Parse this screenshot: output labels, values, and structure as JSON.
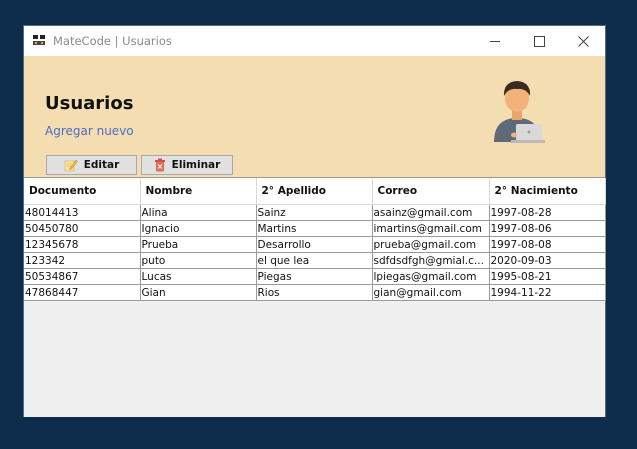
{
  "window": {
    "title": "MateCode | Usuarios"
  },
  "header": {
    "title": "Usuarios",
    "add_link": "Agregar nuevo",
    "background_color": "#f5ddb2"
  },
  "toolbar": {
    "edit_label": "Editar",
    "delete_label": "Eliminar"
  },
  "table": {
    "columns": [
      "Documento",
      "Nombre",
      "2° Apellido",
      "Correo",
      "2° Nacimiento"
    ],
    "rows": [
      [
        "48014413",
        "Alina",
        "Sainz",
        "asainz@gmail.com",
        "1997-08-28"
      ],
      [
        "50450780",
        "Ignacio",
        "Martins",
        "imartins@gmail.com",
        "1997-08-06"
      ],
      [
        "12345678",
        "Prueba",
        "Desarrollo",
        "prueba@gmail.com",
        "1997-08-08"
      ],
      [
        "123342",
        "puto",
        "el que lea",
        "sdfdsdfgh@gmial.c...",
        "2020-09-03"
      ],
      [
        "50534867",
        "Lucas",
        "Piegas",
        "lpiegas@gmail.com",
        "1995-08-21"
      ],
      [
        "47868447",
        "Gian",
        "Rios",
        "gian@gmail.com",
        "1994-11-22"
      ]
    ]
  },
  "icons": {
    "app": "matecode-logo-icon",
    "avatar": "user-laptop-avatar-icon",
    "edit": "pencil-edit-icon",
    "delete": "trash-delete-icon"
  }
}
